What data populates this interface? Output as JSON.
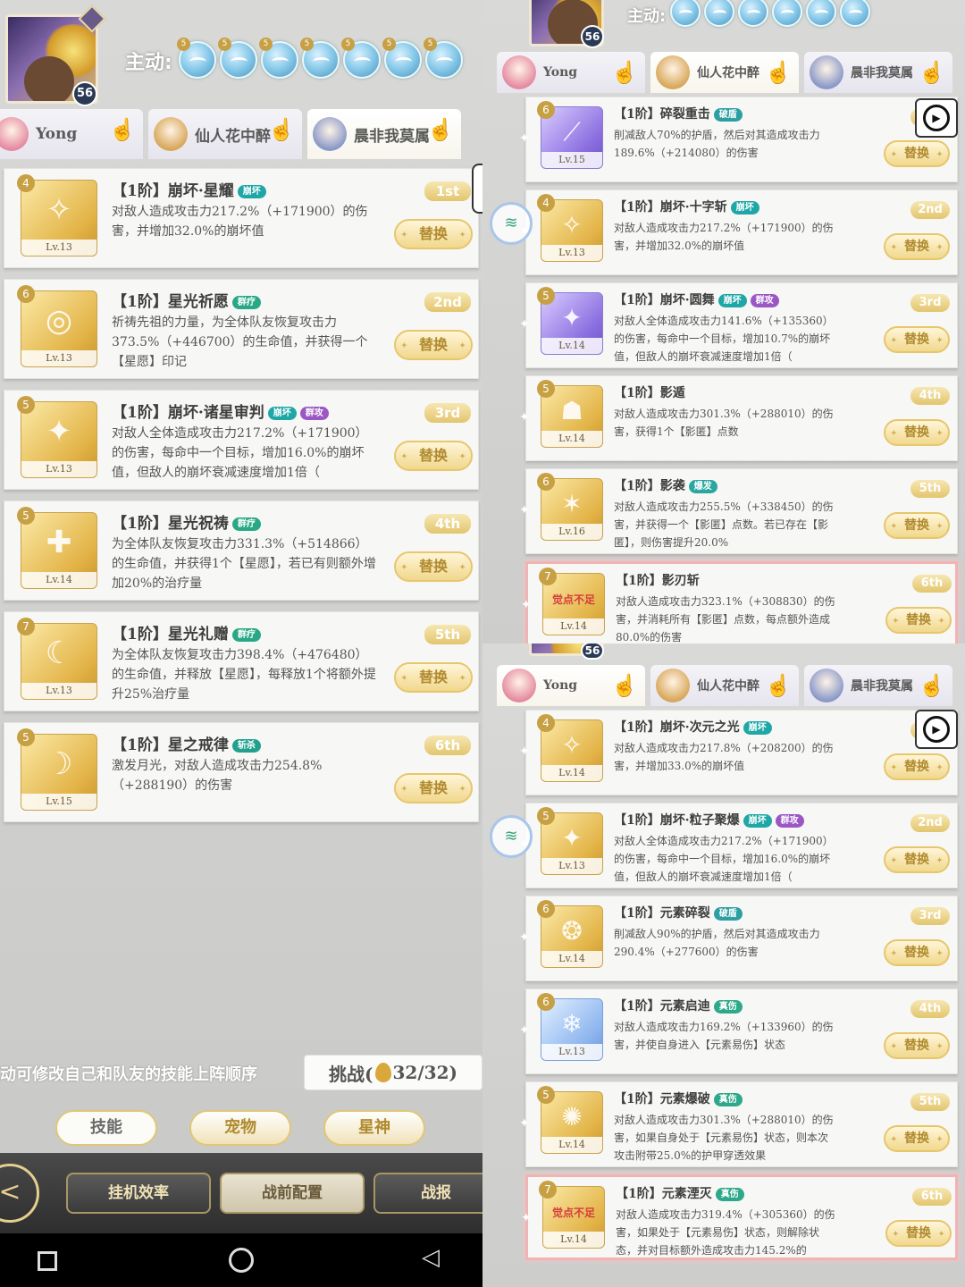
{
  "left": {
    "level": "56",
    "active_label": "主动:",
    "orbs": [
      "5",
      "5",
      "5",
      "5",
      "5",
      "5",
      "5"
    ],
    "tabs": [
      {
        "name": "Yong",
        "selected": false
      },
      {
        "name": "仙人花中醉",
        "selected": false
      },
      {
        "name": "晨非我莫属",
        "selected": true
      }
    ],
    "skills": [
      {
        "stars": "4",
        "lv": "Lv.13",
        "name": "【1阶】崩坏·星耀",
        "tags": [
          "崩坏"
        ],
        "rank": "1st",
        "desc": "对敌人造成攻击力217.2%（+171900）的伤害，并增加32.0%的崩坏值",
        "icon": "gold",
        "glyph": "✧"
      },
      {
        "stars": "6",
        "lv": "Lv.13",
        "name": "【1阶】星光祈愿",
        "tags": [
          "群疗"
        ],
        "rank": "2nd",
        "desc": "祈祷先祖的力量，为全体队友恢复攻击力373.5%（+446700）的生命值，并获得一个【星愿】印记",
        "icon": "gold",
        "glyph": "◎"
      },
      {
        "stars": "5",
        "lv": "Lv.13",
        "name": "【1阶】崩坏·诸星审判",
        "tags": [
          "崩坏",
          "群攻"
        ],
        "rank": "3rd",
        "desc": "对敌人全体造成攻击力217.2%（+171900）的伤害，每命中一个目标，增加16.0%的崩坏值，但敌人的崩坏衰减速度增加1倍（",
        "icon": "gold",
        "glyph": "✦"
      },
      {
        "stars": "5",
        "lv": "Lv.14",
        "name": "【1阶】星光祝祷",
        "tags": [
          "群疗"
        ],
        "rank": "4th",
        "desc": "为全体队友恢复攻击力331.3%（+514866）的生命值，并获得1个【星愿】，若已有则额外增加20%的治疗量",
        "icon": "gold",
        "glyph": "✚"
      },
      {
        "stars": "7",
        "lv": "Lv.13",
        "name": "【1阶】星光礼赠",
        "tags": [
          "群疗"
        ],
        "rank": "5th",
        "desc": "为全体队友恢复攻击力398.4%（+476480）的生命值，并释放【星愿】，每释放1个将额外提升25%治疗量",
        "icon": "gold",
        "glyph": "☾"
      },
      {
        "stars": "5",
        "lv": "Lv.15",
        "name": "【1阶】星之戒律",
        "tags": [
          "斩杀"
        ],
        "rank": "6th",
        "desc": "激发月光，对敌人造成攻击力254.8%（+288190）的伤害",
        "icon": "gold",
        "glyph": "☽"
      }
    ],
    "hint": "拖动可修改自己和队友的技能上阵顺序",
    "challenge": {
      "label": "挑战(",
      "count": "32/32",
      "close": ")"
    },
    "subtabs": [
      "技能",
      "宠物",
      "星神"
    ],
    "bottom_buttons": [
      "挂机效率",
      "战前配置",
      "战报"
    ]
  },
  "right_top": {
    "level": "56",
    "active_label": "主动:",
    "orbs": [
      "",
      "",
      "",
      "",
      "",
      ""
    ],
    "tabs": [
      {
        "name": "Yong",
        "selected": false
      },
      {
        "name": "仙人花中醉",
        "selected": true
      },
      {
        "name": "晨非我莫属",
        "selected": false
      }
    ],
    "skills": [
      {
        "stars": "6",
        "lv": "Lv.15",
        "name": "【1阶】碎裂重击",
        "tags": [
          "破盾"
        ],
        "rank": "1st",
        "desc": "削减敌人70%的护盾，然后对其造成攻击力189.6%（+214080）的伤害",
        "icon": "purple",
        "glyph": "⟋"
      },
      {
        "stars": "4",
        "lv": "Lv.13",
        "name": "【1阶】崩坏·十字斩",
        "tags": [
          "崩坏"
        ],
        "rank": "2nd",
        "desc": "对敌人造成攻击力217.2%（+171900）的伤害，并增加32.0%的崩坏值",
        "icon": "gold",
        "glyph": "✧"
      },
      {
        "stars": "5",
        "lv": "Lv.14",
        "name": "【1阶】崩坏·圆舞",
        "tags": [
          "崩坏",
          "群攻"
        ],
        "rank": "3rd",
        "desc": "对敌人全体造成攻击力141.6%（+135360）的伤害，每命中一个目标，增加10.7%的崩坏值，但敌人的崩坏衰减速度增加1倍（",
        "icon": "purple",
        "glyph": "✦"
      },
      {
        "stars": "5",
        "lv": "Lv.14",
        "name": "【1阶】影遁",
        "tags": [],
        "rank": "4th",
        "desc": "对敌人造成攻击力301.3%（+288010）的伤害，获得1个【影匿】点数",
        "icon": "gold",
        "glyph": "☗"
      },
      {
        "stars": "6",
        "lv": "Lv.16",
        "name": "【1阶】影袭",
        "tags": [
          "爆发"
        ],
        "rank": "5th",
        "desc": "对敌人造成攻击力255.5%（+338450）的伤害，并获得一个【影匿】点数。若已存在【影匿】，则伤害提升20.0%",
        "icon": "gold",
        "glyph": "✶"
      },
      {
        "stars": "7",
        "lv": "Lv.14",
        "name": "【1阶】影刃斩",
        "tags": [],
        "rank": "6th",
        "desc": "对敌人造成攻击力323.1%（+308830）的伤害，并消耗所有【影匿】点数，每点额外造成80.0%的伤害",
        "icon": "gold",
        "glyph": "",
        "warn": "觉点不足"
      }
    ]
  },
  "right_bottom": {
    "level": "56",
    "tabs": [
      {
        "name": "Yong",
        "selected": true
      },
      {
        "name": "仙人花中醉",
        "selected": false
      },
      {
        "name": "晨非我莫属",
        "selected": false
      }
    ],
    "skills": [
      {
        "stars": "4",
        "lv": "Lv.14",
        "name": "【1阶】崩坏·次元之光",
        "tags": [
          "崩坏"
        ],
        "rank": "1st",
        "desc": "对敌人造成攻击力217.8%（+208200）的伤害，并增加33.0%的崩坏值",
        "icon": "gold",
        "glyph": "✧"
      },
      {
        "stars": "5",
        "lv": "Lv.13",
        "name": "【1阶】崩坏·粒子聚爆",
        "tags": [
          "崩坏",
          "群攻"
        ],
        "rank": "2nd",
        "desc": "对敌人全体造成攻击力217.2%（+171900）的伤害，每命中一个目标，增加16.0%的崩坏值，但敌人的崩坏衰减速度增加1倍（",
        "icon": "gold",
        "glyph": "✦"
      },
      {
        "stars": "6",
        "lv": "Lv.14",
        "name": "【1阶】元素碎裂",
        "tags": [
          "破盾"
        ],
        "rank": "3rd",
        "desc": "削减敌人90%的护盾，然后对其造成攻击力290.4%（+277600）的伤害",
        "icon": "gold",
        "glyph": "❂"
      },
      {
        "stars": "6",
        "lv": "Lv.13",
        "name": "【1阶】元素启迪",
        "tags": [
          "真伤"
        ],
        "rank": "4th",
        "desc": "对敌人造成攻击力169.2%（+133960）的伤害，并使自身进入【元素易伤】状态",
        "icon": "blue",
        "glyph": "❄"
      },
      {
        "stars": "5",
        "lv": "Lv.14",
        "name": "【1阶】元素爆破",
        "tags": [
          "真伤"
        ],
        "rank": "5th",
        "desc": "对敌人造成攻击力301.3%（+288010）的伤害，如果自身处于【元素易伤】状态，则本次攻击附带25.0%的护甲穿透效果",
        "icon": "gold",
        "glyph": "✺"
      },
      {
        "stars": "7",
        "lv": "Lv.14",
        "name": "【1阶】元素湮灭",
        "tags": [
          "真伤"
        ],
        "rank": "6th",
        "desc": "对敌人造成攻击力319.4%（+305360）的伤害，如果处于【元素易伤】状态，则解除状态，并对目标额外造成攻击力145.2%的",
        "icon": "gold",
        "glyph": "",
        "warn": "觉点不足"
      }
    ]
  },
  "swap_label": "替换",
  "tag_colors": {
    "崩坏": "#1fa6a6",
    "群疗": "#28a884",
    "群攻": "#9b57c4",
    "斩杀": "#21a08e",
    "破盾": "#2b9fa3",
    "爆发": "#2aa7a0",
    "真伤": "#2ea88a"
  },
  "icons": {
    "play": "play-icon",
    "wifi": "wifi-icon",
    "hand": "pointer-hand-icon",
    "back": "back-arrow-icon"
  },
  "android_nav": [
    "square",
    "circle",
    "triangle"
  ]
}
